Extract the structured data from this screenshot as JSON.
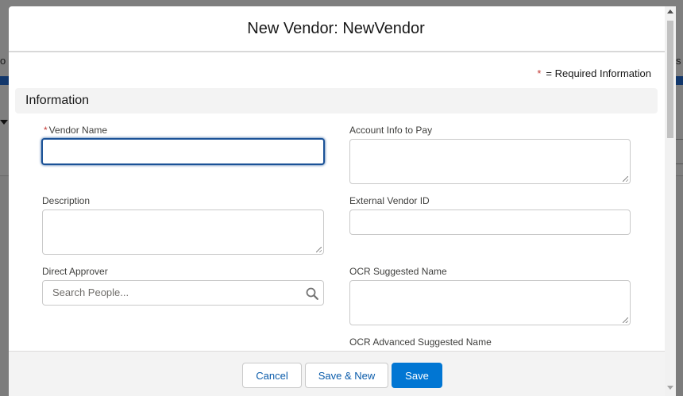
{
  "background": {
    "left_fragment": "o",
    "right_fragment": "s"
  },
  "modal": {
    "title": "New Vendor: NewVendor",
    "required_note": {
      "star": "*",
      "text": "= Required Information"
    },
    "section_title": "Information",
    "fields": {
      "vendor_name": {
        "label": "Vendor Name",
        "required_mark": "*",
        "value": ""
      },
      "account_info": {
        "label": "Account Info to Pay",
        "value": ""
      },
      "description": {
        "label": "Description",
        "value": ""
      },
      "external_vendor_id": {
        "label": "External Vendor ID",
        "value": ""
      },
      "direct_approver": {
        "label": "Direct Approver",
        "placeholder": "Search People..."
      },
      "ocr_suggested_name": {
        "label": "OCR Suggested Name",
        "value": ""
      },
      "ocr_advanced_suggested_name": {
        "label": "OCR Advanced Suggested Name",
        "value": ""
      }
    },
    "footer": {
      "cancel_label": "Cancel",
      "save_new_label": "Save & New",
      "save_label": "Save"
    }
  },
  "colors": {
    "brand": "#0176d3",
    "focus_border": "#1b5297",
    "required": "#c23934",
    "neutral_text": "#0b5cab"
  },
  "icons": {
    "search": "search-icon",
    "scroll_up": "arrow-up-icon",
    "scroll_down": "arrow-down-icon"
  }
}
